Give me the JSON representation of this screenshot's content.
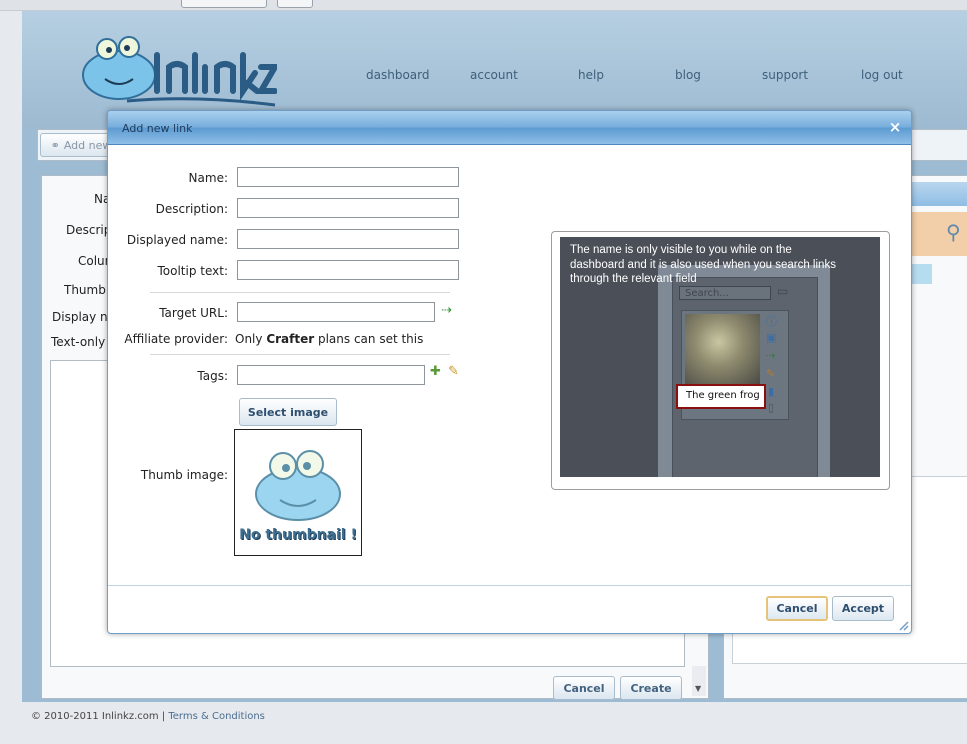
{
  "header": {
    "nav": [
      "dashboard",
      "account",
      "help",
      "blog",
      "support",
      "log out"
    ]
  },
  "background": {
    "add_new_label": "Add new",
    "form_labels": [
      "Na",
      "Descrip",
      "Colun",
      "Thumb",
      "Display na",
      "Text-only l"
    ],
    "cancel_label": "Cancel",
    "create_label": "Create"
  },
  "footer": {
    "copyright": "© 2010-2011 Inlinkz.com | ",
    "terms": "Terms & Conditions"
  },
  "dialog": {
    "title": "Add new link",
    "close": "×",
    "fields": {
      "name_label": "Name:",
      "description_label": "Description:",
      "displayed_name_label": "Displayed name:",
      "tooltip_label": "Tooltip text:",
      "target_url_label": "Target URL:",
      "affiliate_label": "Affiliate provider:",
      "affiliate_text_pre": "Only ",
      "affiliate_text_bold": "Crafter",
      "affiliate_text_post": " plans can set this",
      "tags_label": "Tags:",
      "thumb_label": "Thumb image:",
      "name_value": "",
      "description_value": "",
      "displayed_name_value": "",
      "tooltip_value": "",
      "target_url_value": "",
      "tags_value": ""
    },
    "select_image_label": "Select image",
    "no_thumbnail_text": "No thumbnail !",
    "help_text": "The name is only visible to you while on the dashboard and it is also used when you search links through the relevant field",
    "help_search_placeholder": "Search...",
    "help_tooltip": "The green frog",
    "cancel_label": "Cancel",
    "accept_label": "Accept"
  },
  "colors": {
    "accent": "#5c9ad0",
    "page_bg": "#9dbbd3",
    "highlight_border": "#e5c37a"
  }
}
